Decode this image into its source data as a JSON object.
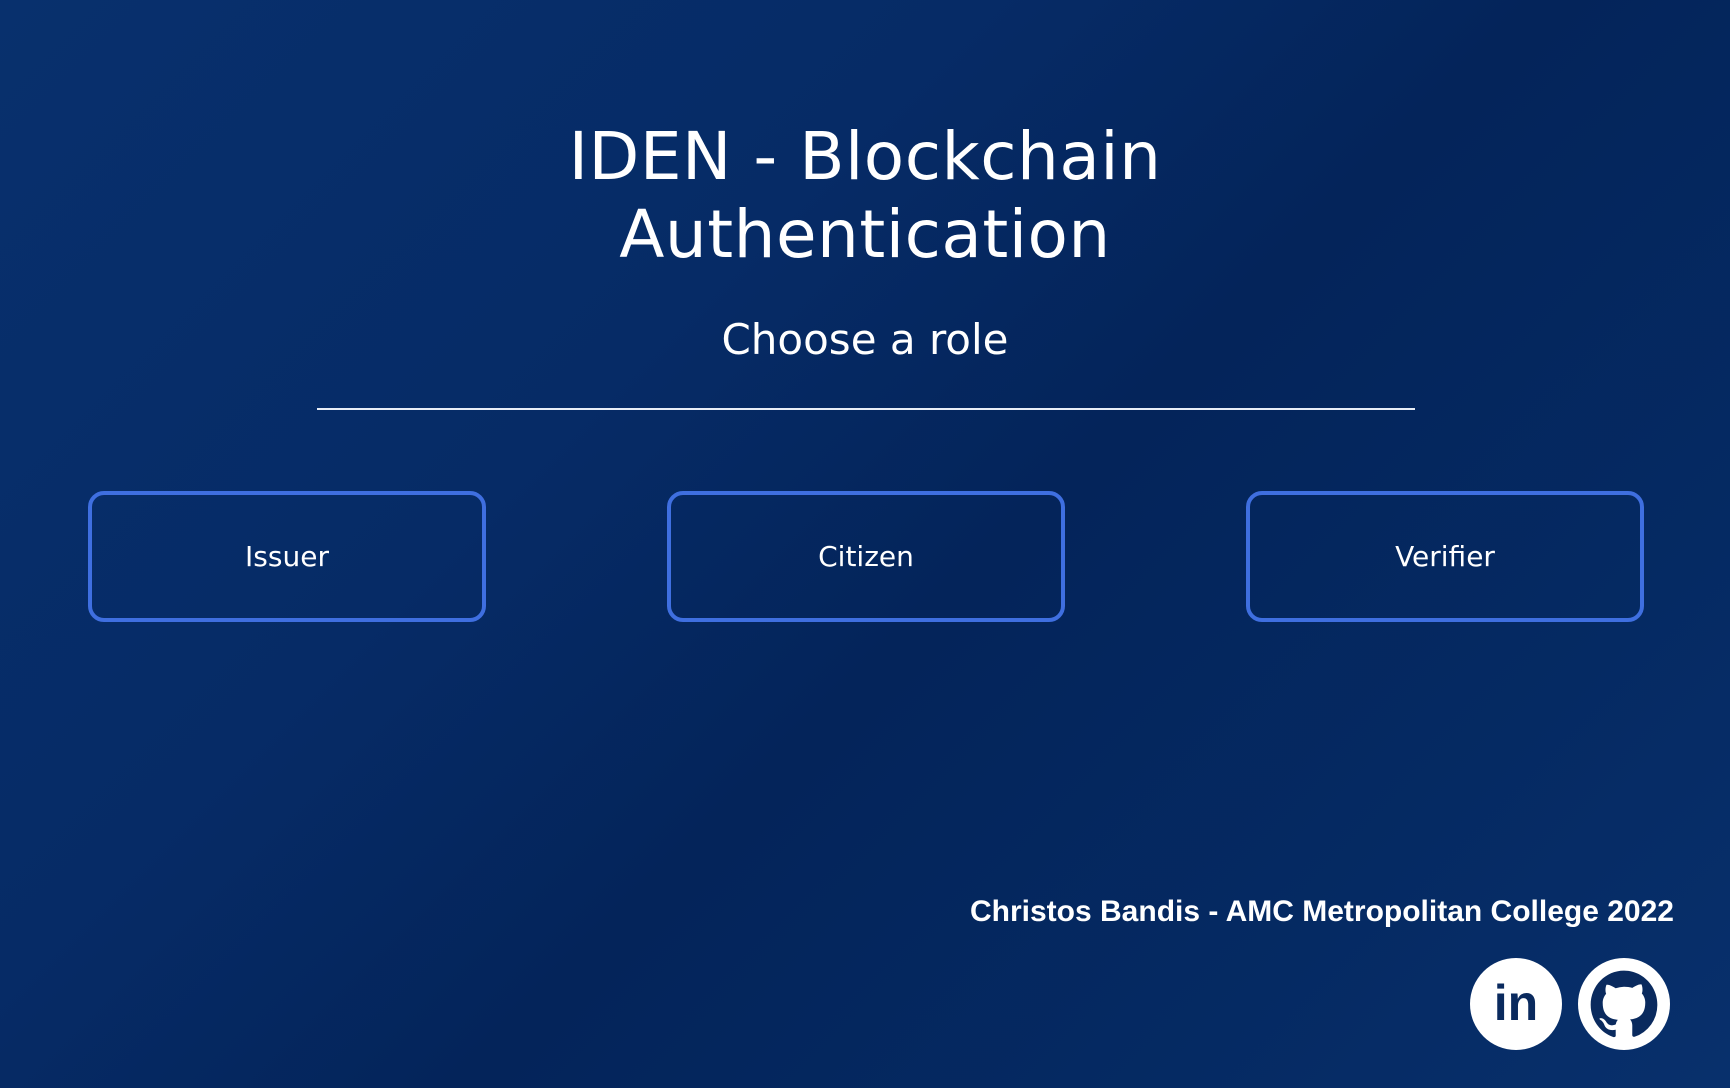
{
  "header": {
    "title_line1": "IDEN - Blockchain",
    "title_line2": "Authentication",
    "subtitle": "Choose a role"
  },
  "roles": [
    {
      "label": "Issuer"
    },
    {
      "label": "Citizen"
    },
    {
      "label": "Verifier"
    }
  ],
  "footer": {
    "credit": "Christos Bandis - AMC Metropolitan College 2022",
    "social": [
      {
        "icon": "linkedin-icon",
        "label": "in"
      },
      {
        "icon": "github-icon"
      }
    ]
  },
  "colors": {
    "background": "#062b66",
    "button_border": "#3f6fe0",
    "text": "#ffffff"
  }
}
